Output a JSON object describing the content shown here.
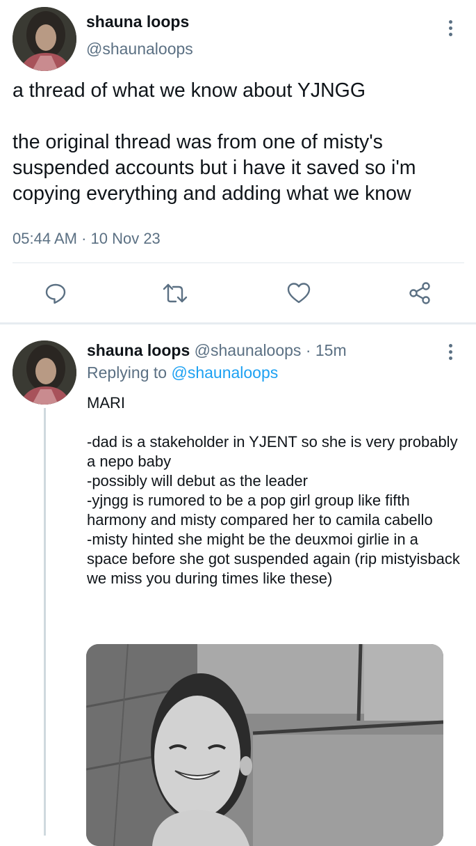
{
  "main_tweet": {
    "display_name": "shauna loops",
    "handle": "@shaunaloops",
    "paragraph_1": "a thread of what we know about YJNGG",
    "paragraph_2": "the original thread was from one of misty's suspended accounts but i have it saved so i'm copying everything and adding what we know",
    "timestamp": "05:44 AM · 10 Nov 23",
    "actions": [
      "reply-icon",
      "retweet-icon",
      "like-icon",
      "share-icon"
    ]
  },
  "reply_tweet": {
    "display_name": "shauna loops",
    "handle_time": "@shaunaloops · 15m",
    "replying_prefix": "Replying to",
    "replying_mention": "@shaunaloops",
    "heading": "MARI",
    "lines": [
      "-dad is a stakeholder in YJENT so she is very probably a nepo baby",
      "-possibly will debut as the leader",
      "-yjngg is rumored to be a pop girl group like fifth harmony and misty compared her to camila cabello",
      "-misty hinted she might be the deuxmoi girlie in a space before she got suspended again (rip mistyisback we miss you during times like these)"
    ]
  },
  "colors": {
    "text": "#0f1419",
    "secondary": "#5b7083",
    "link": "#1da1f2",
    "divider": "#e1e8ed"
  }
}
